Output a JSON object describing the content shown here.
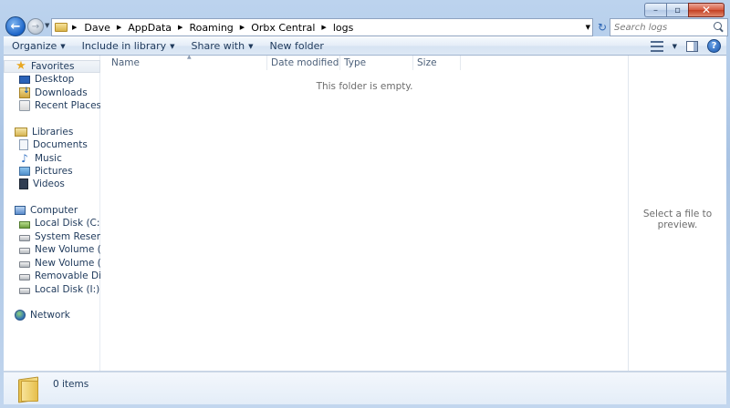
{
  "window": {
    "caption_buttons": {
      "minimize": "–",
      "maximize": "▫",
      "close": "✕"
    }
  },
  "address_bar": {
    "breadcrumbs": [
      "Dave",
      "AppData",
      "Roaming",
      "Orbx Central",
      "logs"
    ]
  },
  "search": {
    "placeholder": "Search logs"
  },
  "commands": {
    "organize": "Organize",
    "include_in_library": "Include in library",
    "share_with": "Share with",
    "new_folder": "New folder"
  },
  "nav_pane": {
    "favorites": {
      "label": "Favorites",
      "items": [
        "Desktop",
        "Downloads",
        "Recent Places"
      ]
    },
    "libraries": {
      "label": "Libraries",
      "items": [
        "Documents",
        "Music",
        "Pictures",
        "Videos"
      ]
    },
    "computer": {
      "label": "Computer",
      "items": [
        "Local Disk (C:)",
        "System Reserved (D:)",
        "New Volume (E:)",
        "New Volume (G:)",
        "Removable Disk (H:)",
        "Local Disk (I:)"
      ]
    },
    "network": {
      "label": "Network"
    }
  },
  "columns": [
    "Name",
    "Date modified",
    "Type",
    "Size"
  ],
  "content": {
    "empty_message": "This folder is empty."
  },
  "preview": {
    "message": "Select a file to preview."
  },
  "details": {
    "item_count": "0 items"
  },
  "colors": {
    "accent": "#1e395b",
    "chrome": "#bcd3ee"
  }
}
